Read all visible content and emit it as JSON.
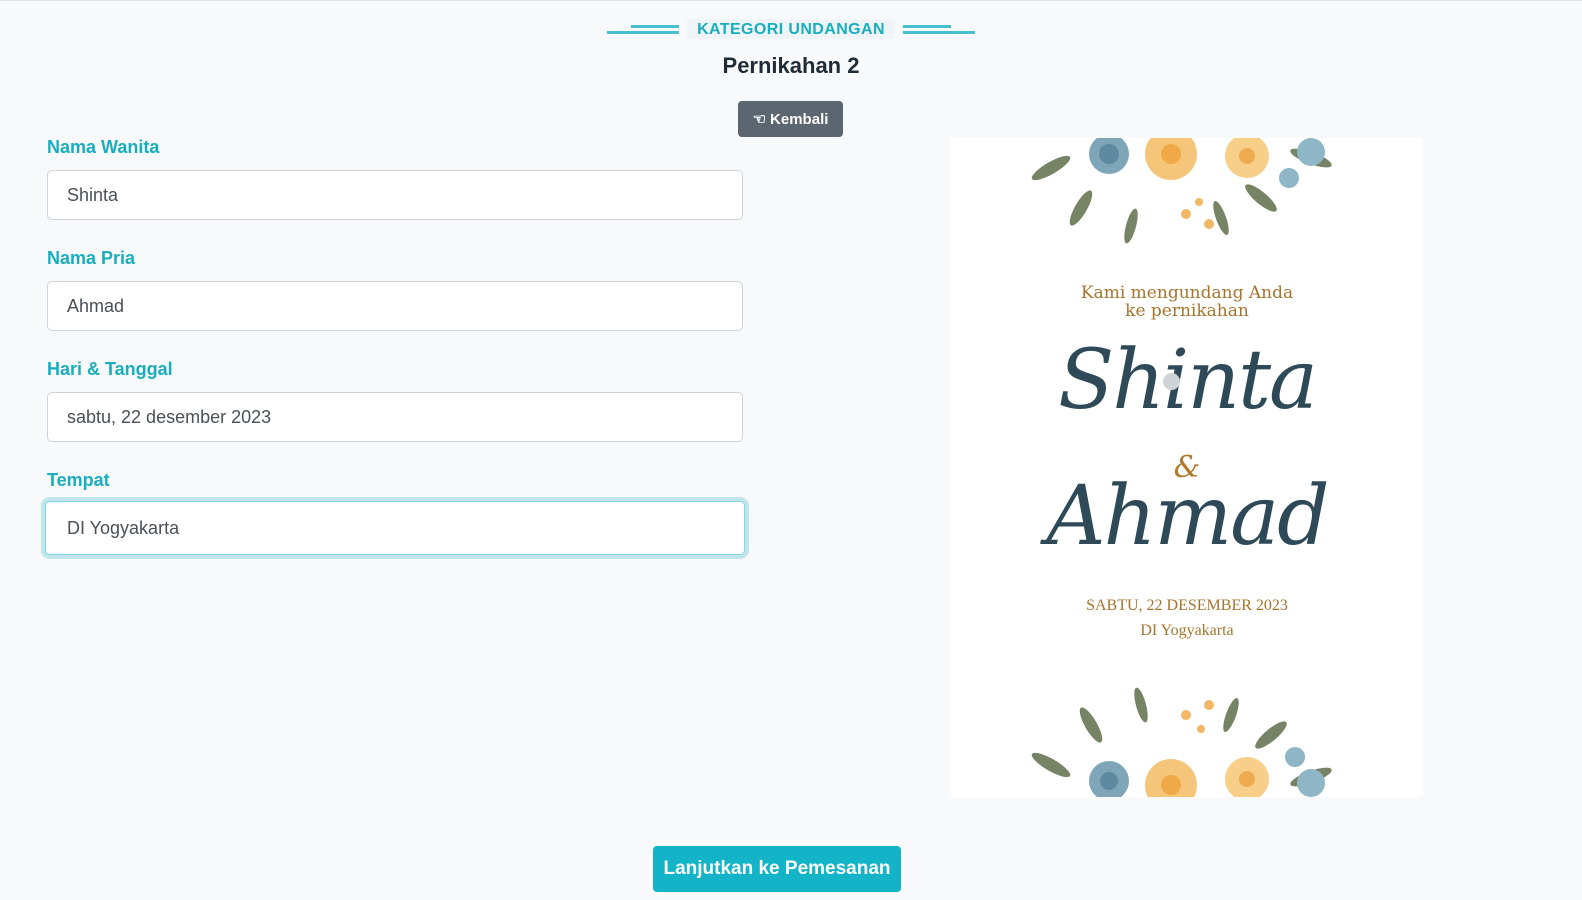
{
  "header": {
    "subtitle": "KATEGORI UNDANGAN",
    "title": "Pernikahan 2",
    "back_label": "Kembali",
    "back_icon": "hand-point-left-icon"
  },
  "form": {
    "fields": [
      {
        "label": "Nama Wanita",
        "value": "Shinta"
      },
      {
        "label": "Nama Pria",
        "value": "Ahmad"
      },
      {
        "label": "Hari & Tanggal",
        "value": "sabtu, 22 desember 2023"
      },
      {
        "label": "Tempat",
        "value": "DI Yogyakarta"
      }
    ],
    "focused_field": "Tempat"
  },
  "preview": {
    "intro_line1": "Kami mengundang Anda",
    "intro_line2": "ke pernikahan",
    "bride": "Shinta",
    "ampersand": "&",
    "groom": "Ahmad",
    "date": "SABTU, 22 DESEMBER 2023",
    "place": "DI Yogyakarta"
  },
  "footer": {
    "submit_label": "Lanjutkan ke Pemesanan"
  },
  "colors": {
    "accent": "#19aebf",
    "button_primary": "#13b3c8",
    "button_secondary": "#5b6670",
    "preview_gold": "#a8742c",
    "preview_name": "#2e4a58"
  }
}
